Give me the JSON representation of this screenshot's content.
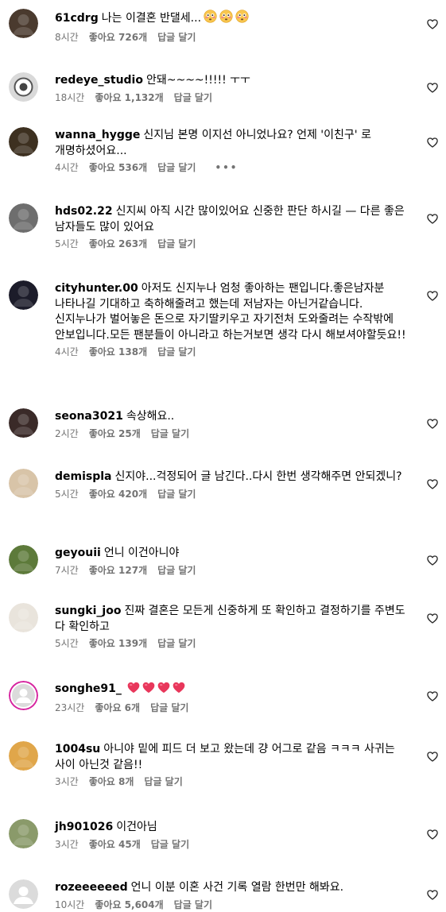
{
  "comments": [
    {
      "username": "61cdrg",
      "text": "나는 이결혼 반댈세...",
      "emojis": [
        "flushed-face",
        "flushed-face",
        "flushed-face"
      ],
      "time": "8시간",
      "likes": "좋아요 726개",
      "reply": "답글 달기",
      "avatar_color": "#4a3a2e"
    },
    {
      "username": "redeye_studio",
      "text": "안돼~~~~!!!!! ㅜㅜ",
      "time": "18시간",
      "likes": "좋아요 1,132개",
      "reply": "답글 달기",
      "avatar_color": "#2b2b2b"
    },
    {
      "username": "wanna_hygge",
      "text": "신지님 본명 이지선 아니었나요? 언제 '이친구' 로 개명하셨어요...",
      "time": "4시간",
      "likes": "좋아요 536개",
      "reply": "답글 달기",
      "more": "•••",
      "avatar_color": "#3d3020"
    },
    {
      "username": "hds02.22",
      "text": "신지씨 아직 시간 많이있어요 신중한 판단 하시길 — 다른 좋은 남자들도 많이 있어요",
      "time": "5시간",
      "likes": "좋아요 263개",
      "reply": "답글 달기",
      "avatar_color": "#6e6e6e"
    },
    {
      "username": "cityhunter.00",
      "text": "아저도 신지누나 엄청 좋아하는 팬입니다.좋은남자분 나타나길 기대하고 축하해줄려고 했는데 저남자는 아닌거같습니다. 신지누나가 벌어놓은 돈으로 자기딸키우고 자기전처 도와줄려는 수작밖에 안보입니다.모든 팬분들이 아니라고 하는거보면 생각 다시 해보셔야할듯요!!",
      "time": "4시간",
      "likes": "좋아요 138개",
      "reply": "답글 달기",
      "avatar_color": "#1c1c2a"
    },
    {
      "username": "seona3021",
      "text": "속상해요..",
      "time": "2시간",
      "likes": "좋아요 25개",
      "reply": "답글 달기",
      "avatar_color": "#3a2a28"
    },
    {
      "username": "demispla",
      "text": "신지야...걱정되어 글 남긴다..다시 한번 생각해주면 안되겠니?",
      "time": "5시간",
      "likes": "좋아요 420개",
      "reply": "답글 달기",
      "avatar_color": "#d8c4a8"
    },
    {
      "username": "geyouii",
      "text": "언니 이건아니야",
      "time": "7시간",
      "likes": "좋아요 127개",
      "reply": "답글 달기",
      "avatar_color": "#5d7a3a"
    },
    {
      "username": "sungki_joo",
      "text": "진짜 결혼은 모든게 신중하게 또 확인하고 결정하기를 주변도 다 확인하고",
      "time": "5시간",
      "likes": "좋아요 139개",
      "reply": "답글 달기",
      "avatar_color": "#e9e4dc"
    },
    {
      "username": "songhe91_",
      "text": "",
      "emojis": [
        "heart",
        "heart",
        "heart",
        "heart"
      ],
      "time": "23시간",
      "likes": "좋아요 6개",
      "reply": "답글 달기",
      "avatar_color": "#c7c7c7"
    },
    {
      "username": "1004su",
      "text": "아니야 밑에 피드 더 보고 왔는데 걍 어그로 같음 ㅋㅋㅋ 사귀는 사이 아닌것 같음!!",
      "time": "3시간",
      "likes": "좋아요 8개",
      "reply": "답글 달기",
      "avatar_color": "#e0a64a"
    },
    {
      "username": "jh901026",
      "text": "이건아님",
      "time": "3시간",
      "likes": "좋아요 45개",
      "reply": "답글 달기",
      "avatar_color": "#8a9a6a"
    },
    {
      "username": "rozeeeeeed",
      "text": "언니 이분 이혼 사건 기록 열람 한번만 해봐요.",
      "time": "10시간",
      "likes": "좋아요 5,604개",
      "reply": "답글 달기",
      "avatar_color": "#d4d4d8"
    }
  ],
  "icons": {
    "like": "heart-outline-icon"
  },
  "colors": {
    "meta": "#737373",
    "heart_emoji": "#e8375b",
    "text": "#000000",
    "background": "#ffffff"
  }
}
